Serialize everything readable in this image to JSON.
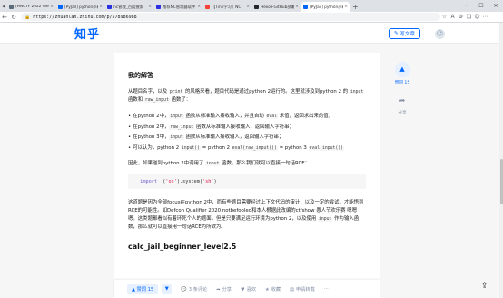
{
  "browser": {
    "tabs": [
      {
        "title": "[HNCTF 2022 Wee",
        "color": "#5b6b7a",
        "active": false
      },
      {
        "title": "[PyJail] python沙箱",
        "color": "#0066ff",
        "active": false
      },
      {
        "title": "nc管理_百度搜索",
        "color": "#2932e1",
        "active": false
      },
      {
        "title": "推荐NC管理器软件",
        "color": "#2932e1",
        "active": false
      },
      {
        "title": "【Tiny学习】NC",
        "color": "#f44336",
        "active": false
      },
      {
        "title": "Hexo+GitHub部署",
        "color": "#24292f",
        "active": false
      },
      {
        "title": "[PyJail] python沙箱",
        "color": "#0066ff",
        "active": true
      }
    ],
    "tab_close_glyph": "×",
    "new_tab_glyph": "+",
    "url": "https://zhuanlan.zhihu.com/p/578986988"
  },
  "header": {
    "logo": "知乎",
    "write_button": "写文章"
  },
  "article": {
    "section_title": "我的解答",
    "para1": {
      "t1": "从题目名字，以及 ",
      "c1": "print",
      "t2": " 的风格来看，题目代码是通过python 2运行的。这里就涉及到python 2 的 ",
      "c2": "input",
      "t3": " 函数和 ",
      "c3": "raw_input",
      "t4": " 函数了："
    },
    "list": [
      {
        "t1": "在python 2中，",
        "c1": "input",
        "t2": " 函数从标准输入接收输入，并且自动 ",
        "c2": "eval",
        "t3": " 求值，返回求出来的值；"
      },
      {
        "t1": "在python 2中，",
        "c1": "raw_input",
        "t2": " 函数从标准输入接收输入，返回输入字符串；",
        "c2": "",
        "t3": ""
      },
      {
        "t1": "在python 3中，",
        "c1": "input",
        "t2": " 函数从标准输入接收输入，返回输入字符串；",
        "c2": "",
        "t3": ""
      },
      {
        "t1": "可以认为，python 2 ",
        "c1": "input()",
        "t2": " = python 2 ",
        "c2": "eval(raw_input())",
        "t3": " = python 3 ",
        "c3": "eval(input())"
      }
    ],
    "para2": {
      "t1": "因此，如果碰到python 2中调用了 ",
      "c1": "input",
      "t2": " 函数，那么我们就可以直接一句话RCE："
    },
    "code": {
      "fn": "__import__",
      "p1": "(",
      "s1": "'os'",
      "p2": ").system(",
      "s2": "'sh'",
      "p3": ")"
    },
    "para3": {
      "t1": "这道题是因为全部focus在python 2中，而有些题目需要经过上下文代码的审计，以及一定的尝试，才能悟到RCE的可能性。如Defcon Qualifier 2020 ",
      "link": "notbefooled",
      "t2": "和本人根据此改编的ctfshow 愚人节欢乐赛 嗯嗯嗯。这类题都看似有着环死个人的题面，但是只要满足运行环境为python 2，以及使用 ",
      "c1": "input",
      "t3": " 作为输入函数，那么就可以直接用一句话RCE为所欲为。"
    },
    "h2": "calc_jail_beginner_level2.5"
  },
  "rail": {
    "upvote_icon": "▲",
    "upvote_label": "赞同 15",
    "share_icon": "➦",
    "share_label": "分享"
  },
  "actionbar": {
    "upvote": "▲ 赞同 15",
    "downvote": "▼",
    "comments": "3 条评论",
    "share": "分享",
    "like": "喜欢",
    "collect": "收藏",
    "apply": "申请转载",
    "more": "···"
  }
}
